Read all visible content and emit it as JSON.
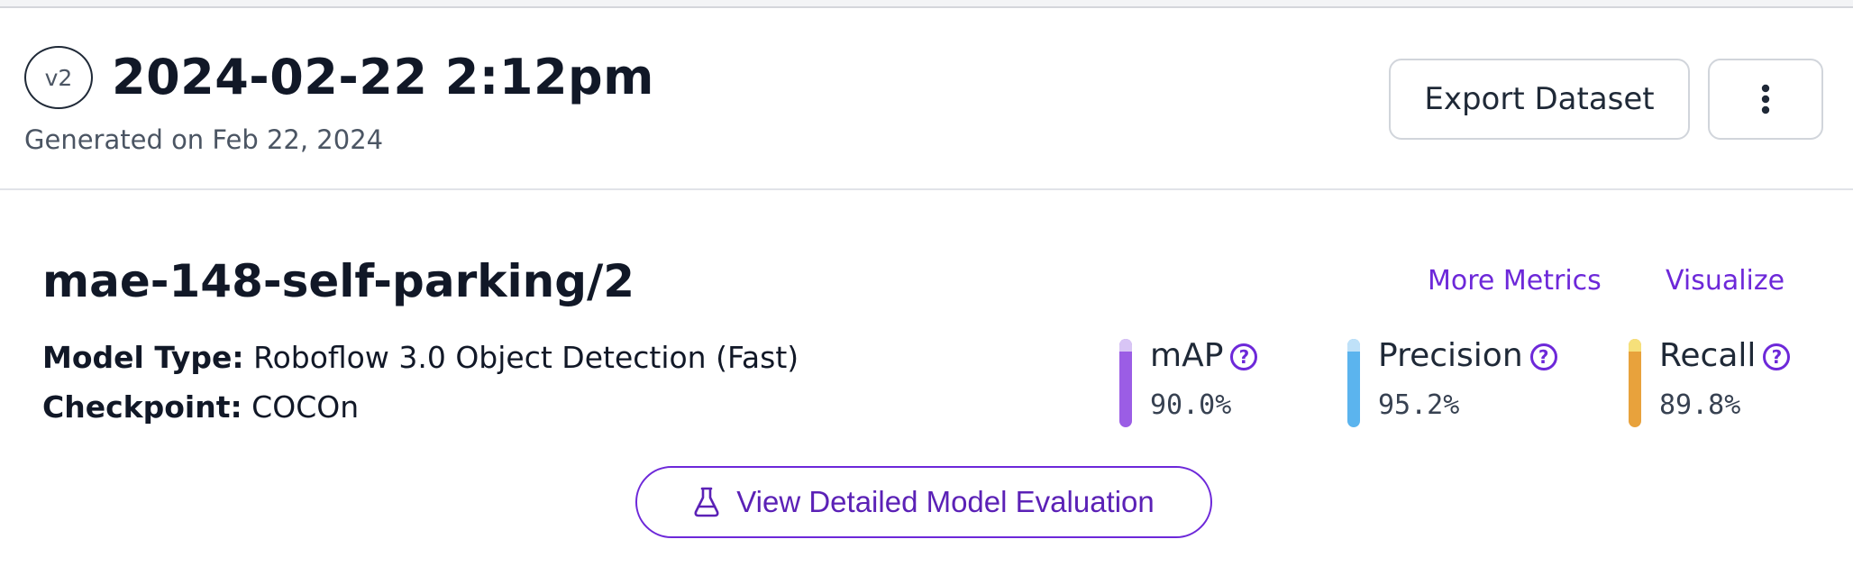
{
  "version": {
    "badge": "v2",
    "title": "2024-02-22 2:12pm",
    "generated": "Generated on Feb 22, 2024"
  },
  "actions": {
    "export_label": "Export Dataset",
    "more_icon": "vertical-ellipsis-icon"
  },
  "model": {
    "name": "mae-148-self-parking/2",
    "links": {
      "more_metrics": "More Metrics",
      "visualize": "Visualize"
    },
    "type_key": "Model Type:",
    "type_value": "Roboflow 3.0 Object Detection (Fast)",
    "checkpoint_key": "Checkpoint:",
    "checkpoint_value": "COCOn",
    "metrics": [
      {
        "label": "mAP",
        "value": "90.0%",
        "color": "#9b5de5",
        "cap_color": "#d8c5f5"
      },
      {
        "label": "Precision",
        "value": "95.2%",
        "color": "#5bb4ee",
        "cap_color": "#bfe1f8"
      },
      {
        "label": "Recall",
        "value": "89.8%",
        "color": "#e8a23c",
        "cap_color": "#f6e07a"
      }
    ],
    "help_icon": "question-circle-icon",
    "evaluation_button": {
      "label": "View Detailed Model Evaluation",
      "icon": "flask-icon"
    }
  },
  "colors": {
    "accent": "#6d28d9",
    "text": "#111827",
    "muted": "#4b5563"
  }
}
